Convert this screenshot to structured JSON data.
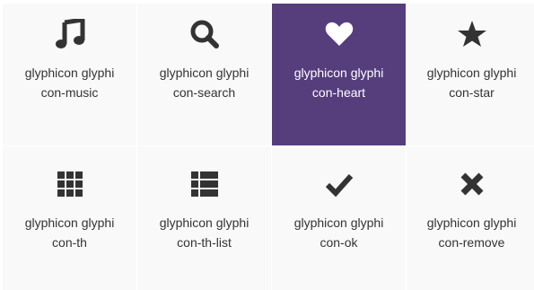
{
  "glyphs": [
    {
      "label": "glyphicon glyphicon-music",
      "icon": "music-icon",
      "active": false
    },
    {
      "label": "glyphicon glyphicon-search",
      "icon": "search-icon",
      "active": false
    },
    {
      "label": "glyphicon glyphicon-heart",
      "icon": "heart-icon",
      "active": true
    },
    {
      "label": "glyphicon glyphicon-star",
      "icon": "star-icon",
      "active": false
    },
    {
      "label": "glyphicon glyphicon-th",
      "icon": "th-icon",
      "active": false
    },
    {
      "label": "glyphicon glyphicon-th-list",
      "icon": "th-list-icon",
      "active": false
    },
    {
      "label": "glyphicon glyphicon-ok",
      "icon": "ok-icon",
      "active": false
    },
    {
      "label": "glyphicon glyphicon-remove",
      "icon": "remove-icon",
      "active": false
    }
  ],
  "colors": {
    "tile_bg": "#f9f9f9",
    "active_bg": "#563d7c",
    "text": "#333333",
    "active_text": "#ffffff"
  }
}
